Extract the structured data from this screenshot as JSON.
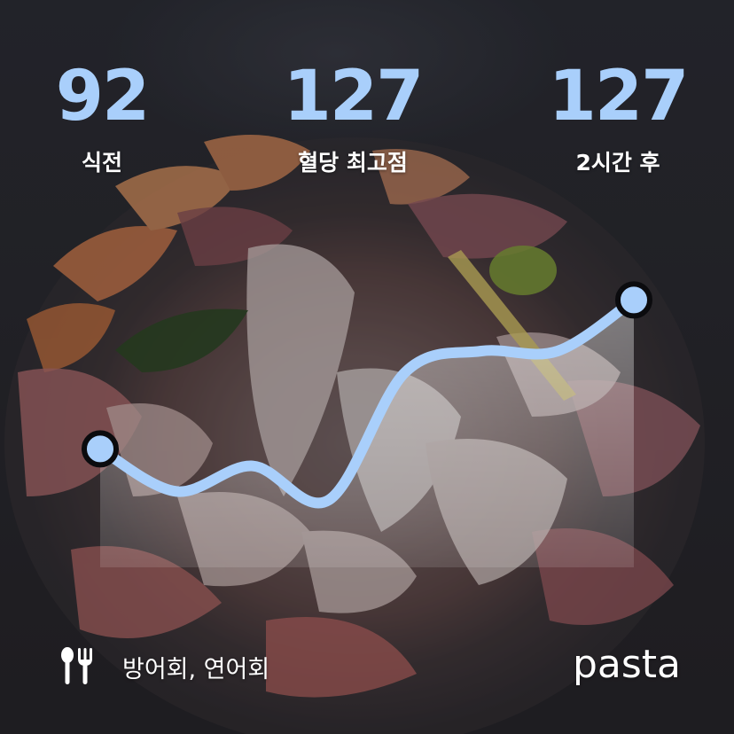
{
  "stats": {
    "before": {
      "value": "92",
      "label": "식전"
    },
    "peak": {
      "value": "127",
      "label": "혈당 최고점"
    },
    "after": {
      "value": "127",
      "label": "2시간 후"
    }
  },
  "chart_data": {
    "type": "line",
    "series": [
      {
        "values": [
          92,
          82,
          88,
          80,
          110,
          115,
          115,
          127
        ]
      }
    ],
    "highlighted_points": [
      {
        "index": 0,
        "value": 92
      },
      {
        "index": 7,
        "value": 127
      }
    ],
    "ylim": [
      70,
      135
    ],
    "grid": false,
    "line_color": "#a9cffb"
  },
  "meal": {
    "icon": "utensils-icon",
    "text": "방어회, 연어회"
  },
  "brand": {
    "text": "pasta"
  },
  "colors": {
    "accent": "#a9cffb",
    "text": "#ffffff"
  }
}
